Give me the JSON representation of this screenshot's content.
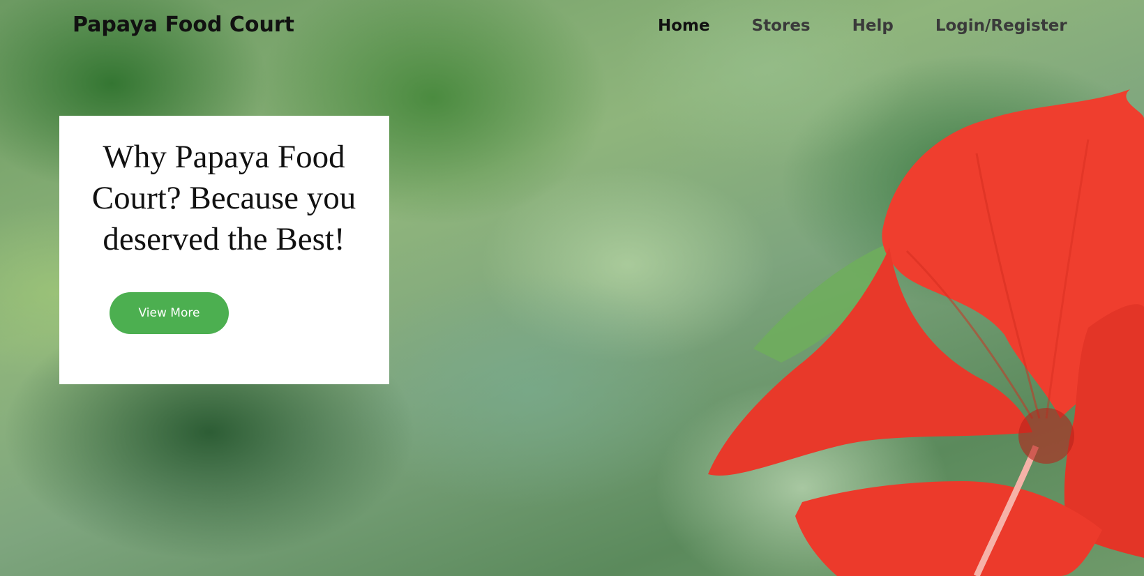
{
  "navbar": {
    "brand": "Papaya Food Court",
    "links": [
      {
        "label": "Home",
        "active": true
      },
      {
        "label": "Stores",
        "active": false
      },
      {
        "label": "Help",
        "active": false
      },
      {
        "label": "Login/Register",
        "active": false
      }
    ]
  },
  "hero": {
    "heading": "Why Papaya Food Court? Because you deserved the Best!",
    "button_label": "View More",
    "button_color": "#4caf50",
    "flower_color": "#ee3b2c"
  }
}
